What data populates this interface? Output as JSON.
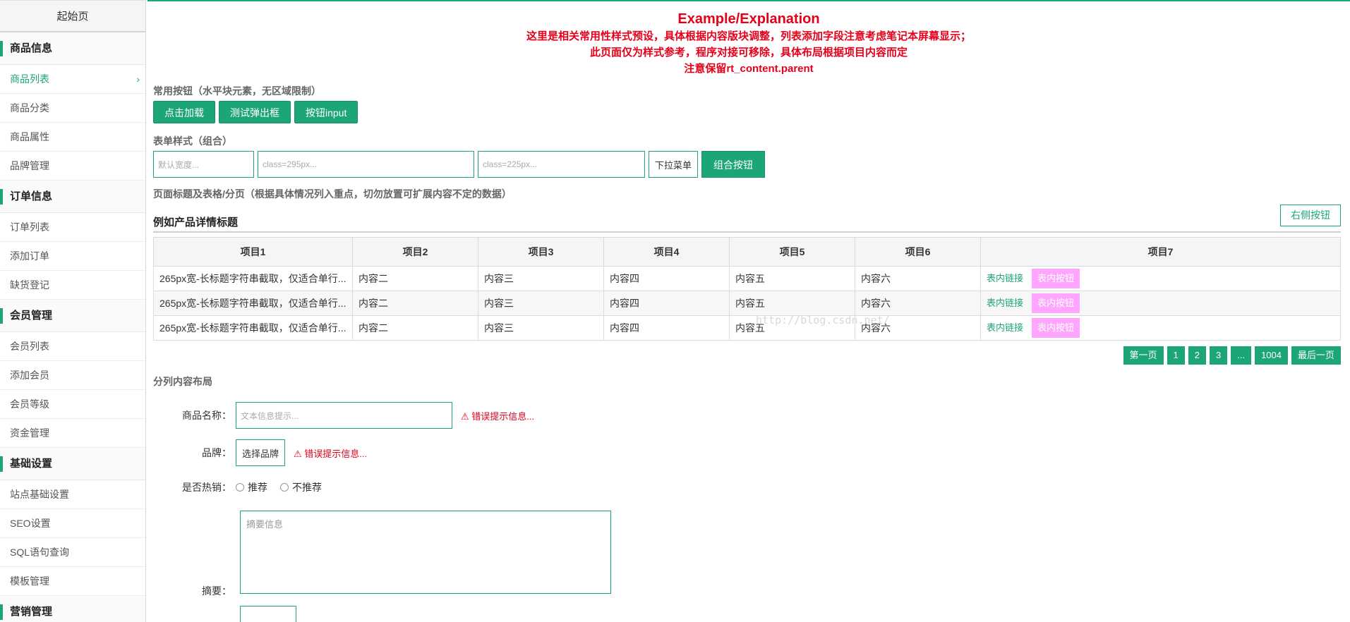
{
  "sidebar": {
    "home": "起始页",
    "groups": [
      {
        "title": "商品信息",
        "items": [
          "商品列表",
          "商品分类",
          "商品属性",
          "品牌管理"
        ]
      },
      {
        "title": "订单信息",
        "items": [
          "订单列表",
          "添加订单",
          "缺货登记"
        ]
      },
      {
        "title": "会员管理",
        "items": [
          "会员列表",
          "添加会员",
          "会员等级",
          "资金管理"
        ]
      },
      {
        "title": "基础设置",
        "items": [
          "站点基础设置",
          "SEO设置",
          "SQL语句查询",
          "模板管理"
        ]
      },
      {
        "title": "营销管理",
        "items": []
      }
    ],
    "active_item": "商品列表"
  },
  "explain": {
    "title": "Example/Explanation",
    "line1": "这里是相关常用性样式预设，具体根据内容版块调整，列表添加字段注意考虑笔记本屏幕显示；",
    "line2": "此页面仅为样式参考，程序对接可移除，具体布局根据项目内容而定",
    "line3": "注意保留rt_content.parent"
  },
  "buttons_section": {
    "label": "常用按钮（水平块元素，无区域限制）",
    "buttons": [
      "点击加载",
      "测试弹出框",
      "按钮input"
    ]
  },
  "form_section": {
    "label": "表单样式（组合）",
    "input1_placeholder": "默认宽度...",
    "input2_placeholder": "class=295px...",
    "input3_placeholder": "class=225px...",
    "dropdown": "下拉菜单",
    "combo_button": "组合按钮"
  },
  "table_section": {
    "label": "页面标题及表格/分页（根据具体情况列入重点，切勿放置可扩展内容不定的数据）",
    "title": "例如产品详情标题",
    "right_button": "右侧按钮",
    "headers": [
      "项目1",
      "项目2",
      "项目3",
      "项目4",
      "项目5",
      "项目6",
      "项目7"
    ],
    "rows": [
      [
        "265px宽-长标题字符串截取，仅适合单行...",
        "内容二",
        "内容三",
        "内容四",
        "内容五",
        "内容六"
      ],
      [
        "265px宽-长标题字符串截取，仅适合单行...",
        "内容二",
        "内容三",
        "内容四",
        "内容五",
        "内容六"
      ],
      [
        "265px宽-长标题字符串截取，仅适合单行...",
        "内容二",
        "内容三",
        "内容四",
        "内容五",
        "内容六"
      ]
    ],
    "row_link": "表内链接",
    "row_button": "表内按钮",
    "watermark": "http://blog.csdn.net/"
  },
  "pager": [
    "第一页",
    "1",
    "2",
    "3",
    "...",
    "1004",
    "最后一页"
  ],
  "layout_section": {
    "label": "分列内容布局",
    "product_name_label": "商品名称：",
    "product_name_placeholder": "文本信息提示...",
    "error_text": "⚠ 错误提示信息...",
    "brand_label": "品牌：",
    "brand_select": "选择品牌",
    "hot_label": "是否热销：",
    "radio_yes": "推荐",
    "radio_no": "不推荐",
    "summary_label": "摘要：",
    "summary_placeholder": "摘要信息"
  },
  "colors": {
    "accent": "#1da57a",
    "error": "#e5001a",
    "pink_button": "#ffa5ff"
  }
}
